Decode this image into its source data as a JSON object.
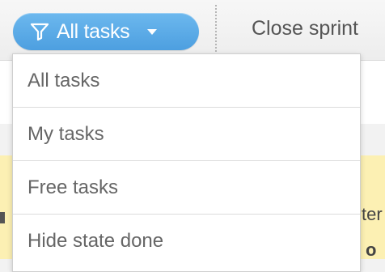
{
  "toolbar": {
    "filter_button": {
      "icon": "filter-icon",
      "label": "All tasks",
      "caret_icon": "caret-down-icon",
      "color": "#56a6e6"
    },
    "close_sprint_label": "Close sprint"
  },
  "dropdown": {
    "items": [
      {
        "label": "All tasks"
      },
      {
        "label": "My tasks"
      },
      {
        "label": "Free tasks"
      },
      {
        "label": "Hide state done"
      }
    ]
  },
  "background": {
    "highlight_color": "#fcf0b3",
    "fragment_a": "ter",
    "fragment_b": "o"
  }
}
